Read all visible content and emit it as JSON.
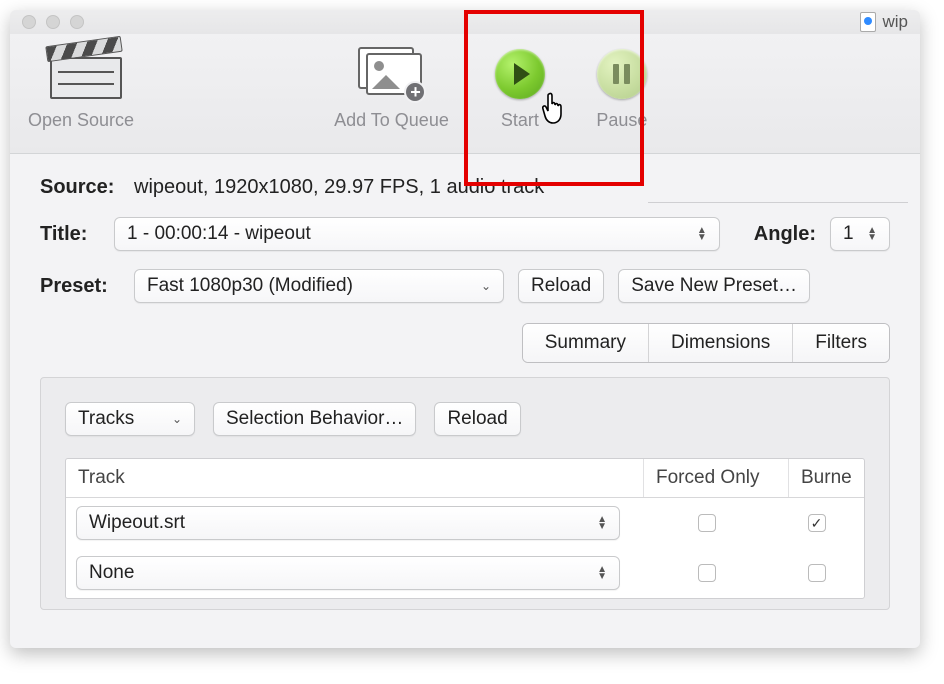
{
  "titlebar": {
    "doc_name": "wip"
  },
  "toolbar": {
    "open_label": "Open Source",
    "queue_label": "Add To Queue",
    "start_label": "Start",
    "pause_label": "Pause"
  },
  "source": {
    "label": "Source:",
    "text": "wipeout, 1920x1080, 29.97 FPS, 1 audio track"
  },
  "title": {
    "label": "Title:",
    "value": "1 - 00:00:14 - wipeout"
  },
  "angle": {
    "label": "Angle:",
    "value": "1"
  },
  "preset": {
    "label": "Preset:",
    "value": "Fast 1080p30 (Modified)",
    "reload_label": "Reload",
    "save_label": "Save New Preset…"
  },
  "tabs": {
    "summary": "Summary",
    "dimensions": "Dimensions",
    "filters": "Filters"
  },
  "tracks": {
    "dropdown_label": "Tracks",
    "behavior_label": "Selection Behavior…",
    "reload_label": "Reload",
    "headers": {
      "track": "Track",
      "forced": "Forced Only",
      "burned": "Burne"
    },
    "rows": [
      {
        "name": "Wipeout.srt",
        "forced": false,
        "burned": true
      },
      {
        "name": "None",
        "forced": false,
        "burned": false
      }
    ]
  }
}
